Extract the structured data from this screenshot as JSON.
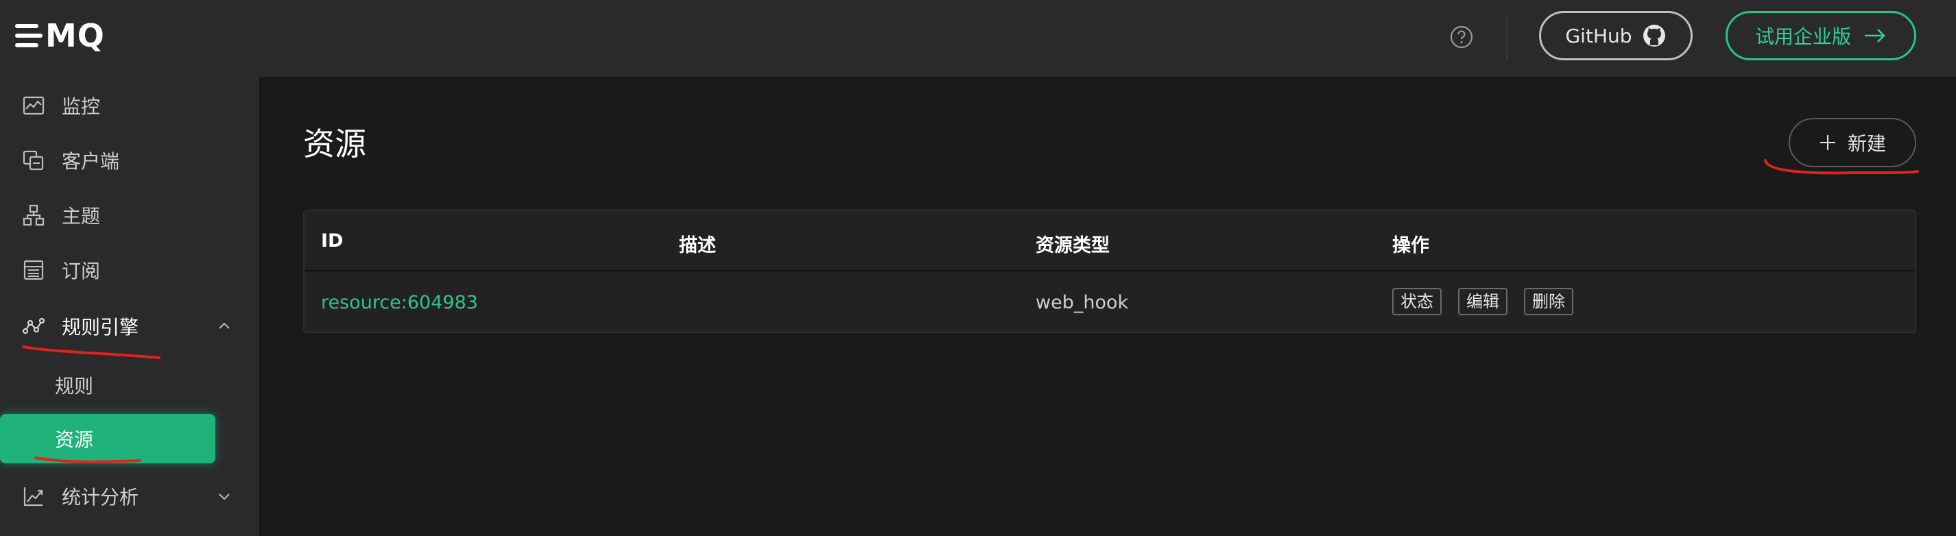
{
  "logo": {
    "text": "MQ"
  },
  "sidebar": {
    "items": [
      {
        "label": "监控",
        "icon": "monitor-icon"
      },
      {
        "label": "客户端",
        "icon": "clients-icon"
      },
      {
        "label": "主题",
        "icon": "topics-icon"
      },
      {
        "label": "订阅",
        "icon": "subscriptions-icon"
      },
      {
        "label": "规则引擎",
        "icon": "rule-engine-icon",
        "expanded": true
      },
      {
        "label": "统计分析",
        "icon": "analysis-icon",
        "expanded": false
      }
    ],
    "sub_items": [
      {
        "label": "规则",
        "active": false
      },
      {
        "label": "资源",
        "active": true
      }
    ]
  },
  "header": {
    "help_icon": "help-icon",
    "github_label": "GitHub",
    "trial_label": "试用企业版"
  },
  "main": {
    "title": "资源",
    "new_button_label": "新建",
    "table": {
      "columns": [
        "ID",
        "描述",
        "资源类型",
        "操作"
      ],
      "rows": [
        {
          "id": "resource:604983",
          "description": "",
          "type": "web_hook",
          "actions": [
            "状态",
            "编辑",
            "删除"
          ]
        }
      ]
    }
  },
  "colors": {
    "accent": "#1fb37b",
    "link": "#2fc486",
    "sidebar_bg": "#2a2a2c",
    "page_bg": "#1a1a1b",
    "annotation": "#e0231b"
  }
}
